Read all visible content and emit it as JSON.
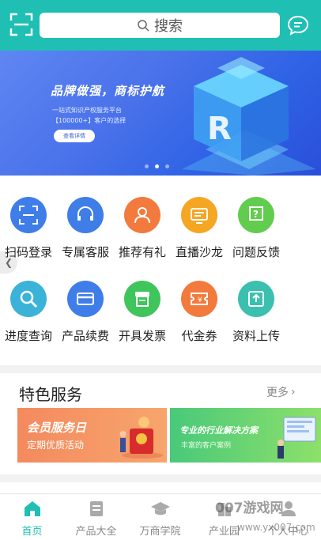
{
  "header": {
    "search_placeholder": "搜索",
    "accent": "#1fbfb3"
  },
  "banner": {
    "headline": "品牌做强，商标护航",
    "sub1": "一站式知识产权服务平台",
    "sub2": "【100000+】客户的选择",
    "button_label": "查看详情",
    "slide_count": 3,
    "active_slide": 2
  },
  "grid": {
    "row1": [
      {
        "label": "扫码登录",
        "icon": "scan-icon",
        "color": "#3f7de8"
      },
      {
        "label": "专属客服",
        "icon": "headset-icon",
        "color": "#3f7de8"
      },
      {
        "label": "推荐有礼",
        "icon": "user-icon",
        "color": "#f27a3d"
      },
      {
        "label": "直播沙龙",
        "icon": "live-icon",
        "color": "#f5a623"
      },
      {
        "label": "问题反馈",
        "icon": "question-icon",
        "color": "#62cc4f"
      }
    ],
    "row2": [
      {
        "label": "进度查询",
        "icon": "magnifier-icon",
        "color": "#3bb3d9"
      },
      {
        "label": "产品续费",
        "icon": "card-icon",
        "color": "#3f7de8"
      },
      {
        "label": "开具发票",
        "icon": "invoice-icon",
        "color": "#3fc55b"
      },
      {
        "label": "代金券",
        "icon": "coupon-icon",
        "color": "#f27a3d"
      },
      {
        "label": "资料上传",
        "icon": "upload-icon",
        "color": "#3bc0b0"
      }
    ]
  },
  "featured": {
    "title": "特色服务",
    "more": "更多",
    "cards": [
      {
        "t1": "会员服务日",
        "t2": "定期优质活动"
      },
      {
        "t1": "专业的行业解决方案",
        "t2": "丰富的客户案例"
      }
    ]
  },
  "nav": {
    "items": [
      {
        "label": "首页",
        "icon": "home-icon",
        "active": true
      },
      {
        "label": "产品大全",
        "icon": "document-icon"
      },
      {
        "label": "万商学院",
        "icon": "graduation-cap-icon"
      },
      {
        "label": "产业园",
        "icon": "building-icon"
      },
      {
        "label": "个人中心",
        "icon": "user-icon"
      }
    ]
  },
  "watermark": {
    "text": "007游戏网",
    "url": "www.yx007.com"
  }
}
